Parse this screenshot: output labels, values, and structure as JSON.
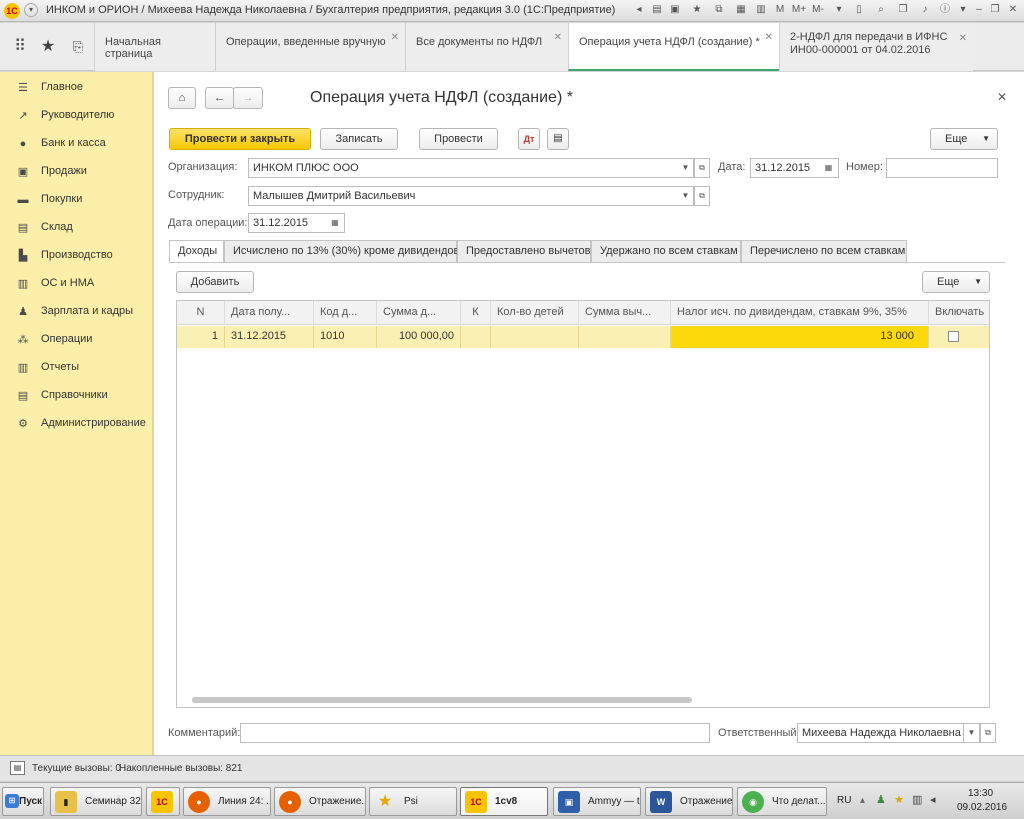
{
  "window": {
    "title": "ИНКОМ и ОРИОН / Михеева Надежда Николаевна / Бухгалтерия предприятия, редакция 3.0  (1С:Предприятие)",
    "controls": [
      "M",
      "M+",
      "M-"
    ]
  },
  "tabs": [
    {
      "label": "Начальная страница",
      "closable": false
    },
    {
      "label": "Операции, введенные вручную",
      "closable": true
    },
    {
      "label": "Все документы по НДФЛ",
      "closable": true
    },
    {
      "label": "Операция учета НДФЛ (создание) *",
      "closable": true,
      "active": true
    },
    {
      "label": "2-НДФЛ для передачи в ИФНС",
      "label2": "ИН00-000001 от 04.02.2016",
      "closable": true
    }
  ],
  "sidebar": {
    "items": [
      {
        "label": "Главное",
        "icon": "menu-lines-icon"
      },
      {
        "label": "Руководителю",
        "icon": "trend-icon"
      },
      {
        "label": "Банк и касса",
        "icon": "coin-icon"
      },
      {
        "label": "Продажи",
        "icon": "cart-icon"
      },
      {
        "label": "Покупки",
        "icon": "truck-icon"
      },
      {
        "label": "Склад",
        "icon": "warehouse-icon"
      },
      {
        "label": "Производство",
        "icon": "factory-icon"
      },
      {
        "label": "ОС и НМА",
        "icon": "building-icon"
      },
      {
        "label": "Зарплата и кадры",
        "icon": "person-icon"
      },
      {
        "label": "Операции",
        "icon": "operations-icon"
      },
      {
        "label": "Отчеты",
        "icon": "bar-chart-icon"
      },
      {
        "label": "Справочники",
        "icon": "book-icon"
      },
      {
        "label": "Администрирование",
        "icon": "gear-icon"
      }
    ]
  },
  "form": {
    "title": "Операция учета НДФЛ (создание) *",
    "buttons": {
      "post_close": "Провести и закрыть",
      "save": "Записать",
      "post": "Провести",
      "more": "Еще"
    },
    "organization": {
      "label": "Организация:",
      "value": "ИНКОМ ПЛЮС ООО"
    },
    "date": {
      "label": "Дата:",
      "value": "31.12.2015"
    },
    "number": {
      "label": "Номер:",
      "value": ""
    },
    "employee": {
      "label": "Сотрудник:",
      "value": "Малышев Дмитрий Васильевич"
    },
    "operation_date": {
      "label": "Дата операции:",
      "value": "31.12.2015"
    },
    "content_tabs": [
      "Доходы",
      "Исчислено по 13% (30%) кроме дивидендов",
      "Предоставлено вычетов",
      "Удержано по всем ставкам",
      "Перечислено по всем ставкам"
    ],
    "table_buttons": {
      "add": "Добавить",
      "more": "Еще"
    },
    "table": {
      "columns": [
        "N",
        "Дата полу...",
        "Код д...",
        "Сумма д...",
        "К",
        "Кол-во детей",
        "Сумма выч...",
        "Налог исч. по дивидендам, ставкам 9%, 35%",
        "Включать"
      ],
      "rows": [
        [
          "1",
          "31.12.2015",
          "1010",
          "100 000,00",
          "",
          "",
          "",
          "13 000",
          ""
        ]
      ]
    },
    "comment": {
      "label": "Комментарий:",
      "value": ""
    },
    "responsible": {
      "label": "Ответственный:",
      "value": "Михеева Надежда Николаевна"
    }
  },
  "statusbar": {
    "current_calls": "Текущие вызовы: 0",
    "accumulated_calls": "Накопленные вызовы: 821"
  },
  "taskbar": {
    "start": "Пуск",
    "items": [
      {
        "label": "Семинар 32ч",
        "icon": "folder-icon"
      },
      {
        "label": "1С",
        "icon": "1c-icon"
      },
      {
        "label": "Линия 24: ...",
        "icon": "firefox-icon"
      },
      {
        "label": "Отражение...",
        "icon": "firefox-icon"
      },
      {
        "label": "Psi",
        "icon": "star-icon"
      },
      {
        "label": "1cv8",
        "icon": "1c-icon"
      },
      {
        "label": "Ammyy — t...",
        "icon": "ammyy-icon"
      },
      {
        "label": "Отражение...",
        "icon": "word-icon"
      },
      {
        "label": "Что делат...",
        "icon": "chrome-icon"
      }
    ],
    "lang": "RU",
    "time": "13:30",
    "date": "09.02.2016"
  },
  "colors": {
    "sidebar_bg": "#fbeea9",
    "primary_button": "#f5c800",
    "selected_row": "#fbf0b4",
    "highlight_cell": "#fdd80a",
    "active_tab_underline": "#3aa76d"
  }
}
